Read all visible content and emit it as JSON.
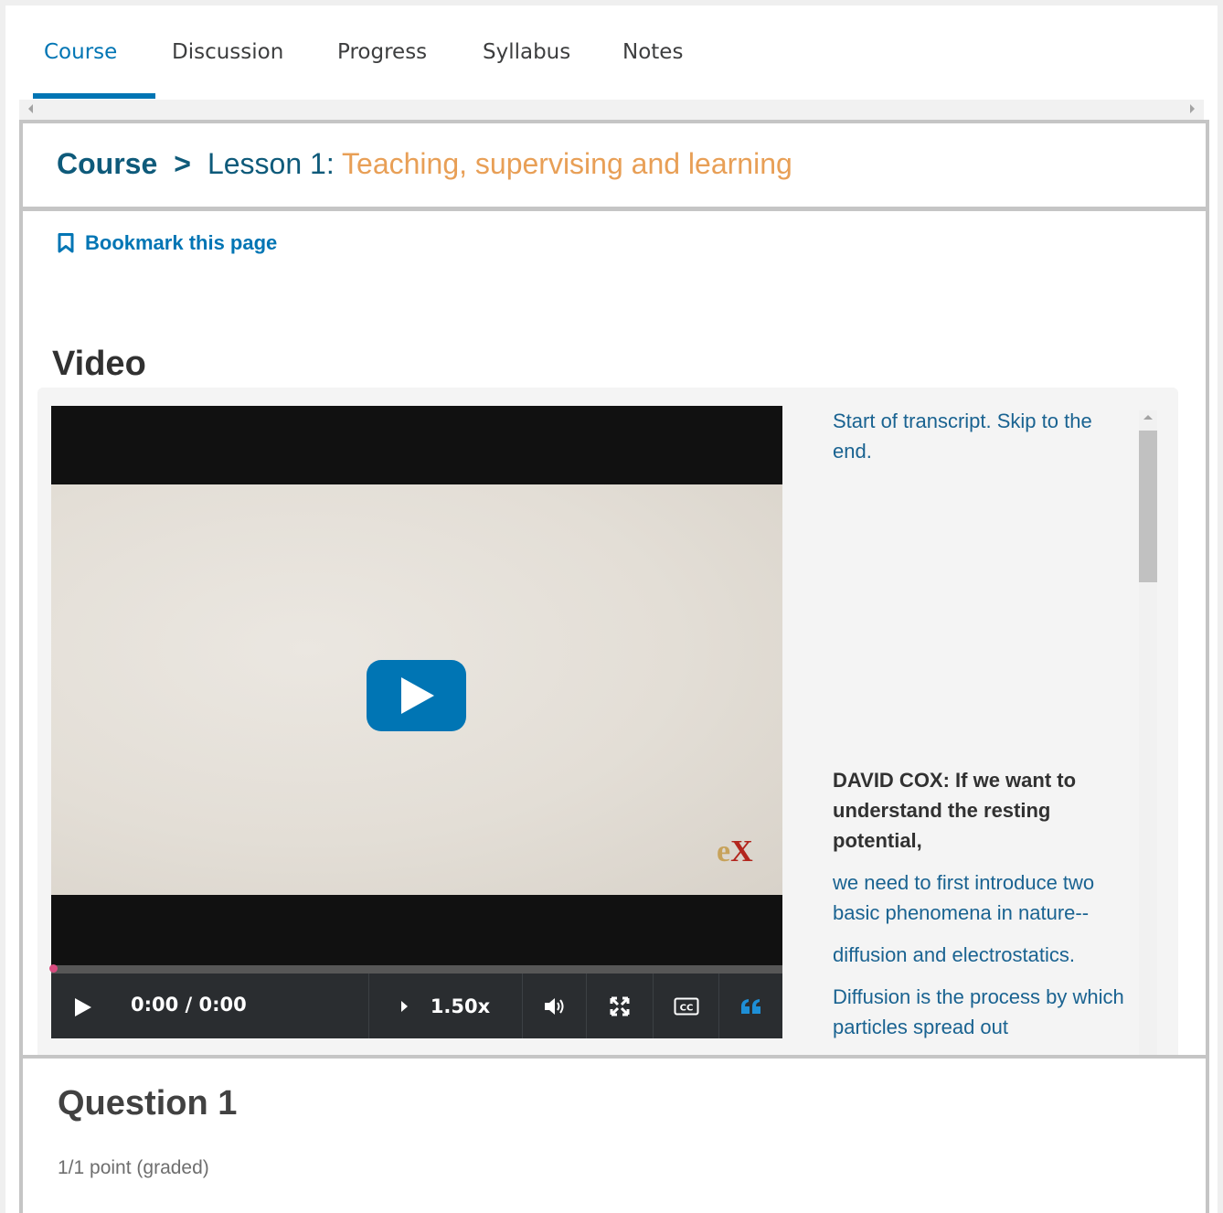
{
  "tabs": [
    {
      "label": "Course",
      "active": true
    },
    {
      "label": "Discussion",
      "active": false
    },
    {
      "label": "Progress",
      "active": false
    },
    {
      "label": "Syllabus",
      "active": false
    },
    {
      "label": "Notes",
      "active": false
    }
  ],
  "breadcrumb": {
    "course": "Course",
    "separator": ">",
    "lesson": "Lesson 1",
    "colon": ":",
    "title": " Teaching, supervising and learning"
  },
  "bookmark": {
    "label": "Bookmark this page",
    "icon": "bookmark-icon"
  },
  "video": {
    "heading": "Video",
    "time": "0:00 / 0:00",
    "speed": "1.50x",
    "progress": 0,
    "icons": [
      "play-icon",
      "volume-icon",
      "fullscreen-icon",
      "closed-captions-icon",
      "transcript-quote-icon"
    ]
  },
  "transcript": {
    "skip": "Start of transcript. Skip to the end.",
    "lines": [
      "DAVID COX: If we want to understand the resting potential,",
      "we need to first introduce two basic phenomena in nature--",
      "diffusion and electrostatics.",
      "Diffusion is the process by which particles spread out"
    ]
  },
  "question": {
    "title": "Question 1",
    "points": "1/1 point (graded)"
  },
  "colors": {
    "accent": "#0075b4",
    "breadcrumb_text": "#0e5a7a",
    "breadcrumb_title": "#e89f56",
    "progress_knob": "#d94b7f"
  }
}
